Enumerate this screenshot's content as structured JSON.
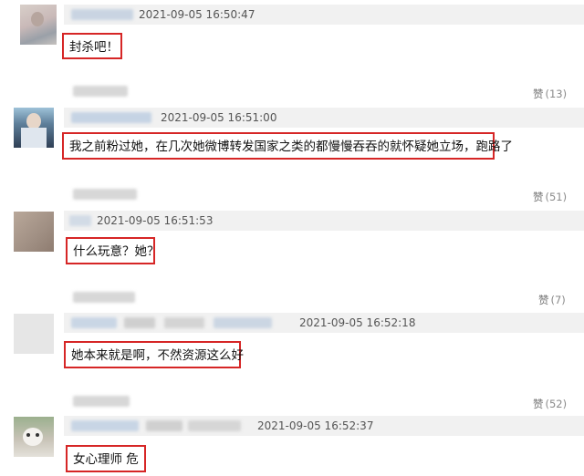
{
  "comments": [
    {
      "timestamp": "2021-09-05 16:50:47",
      "text": "封杀吧！",
      "likes": null
    },
    {
      "timestamp": "2021-09-05 16:51:00",
      "text": "我之前粉过她，在几次她微博转发国家之类的都慢慢吞吞的就怀疑她立场，跑路了",
      "likes": "(13)"
    },
    {
      "timestamp": "2021-09-05 16:51:53",
      "text": "什么玩意？她？",
      "likes": "(51)"
    },
    {
      "timestamp": "2021-09-05 16:52:18",
      "text": "她本来就是啊，不然资源这么好",
      "likes": "(7)"
    },
    {
      "timestamp": "2021-09-05 16:52:37",
      "text": "女心理师 危",
      "likes": "(52)"
    }
  ],
  "like_glyph": "赞",
  "colors": {
    "highlight": "#d62626",
    "header_bg": "#f1f1f1",
    "muted": "#8a8a8a"
  }
}
